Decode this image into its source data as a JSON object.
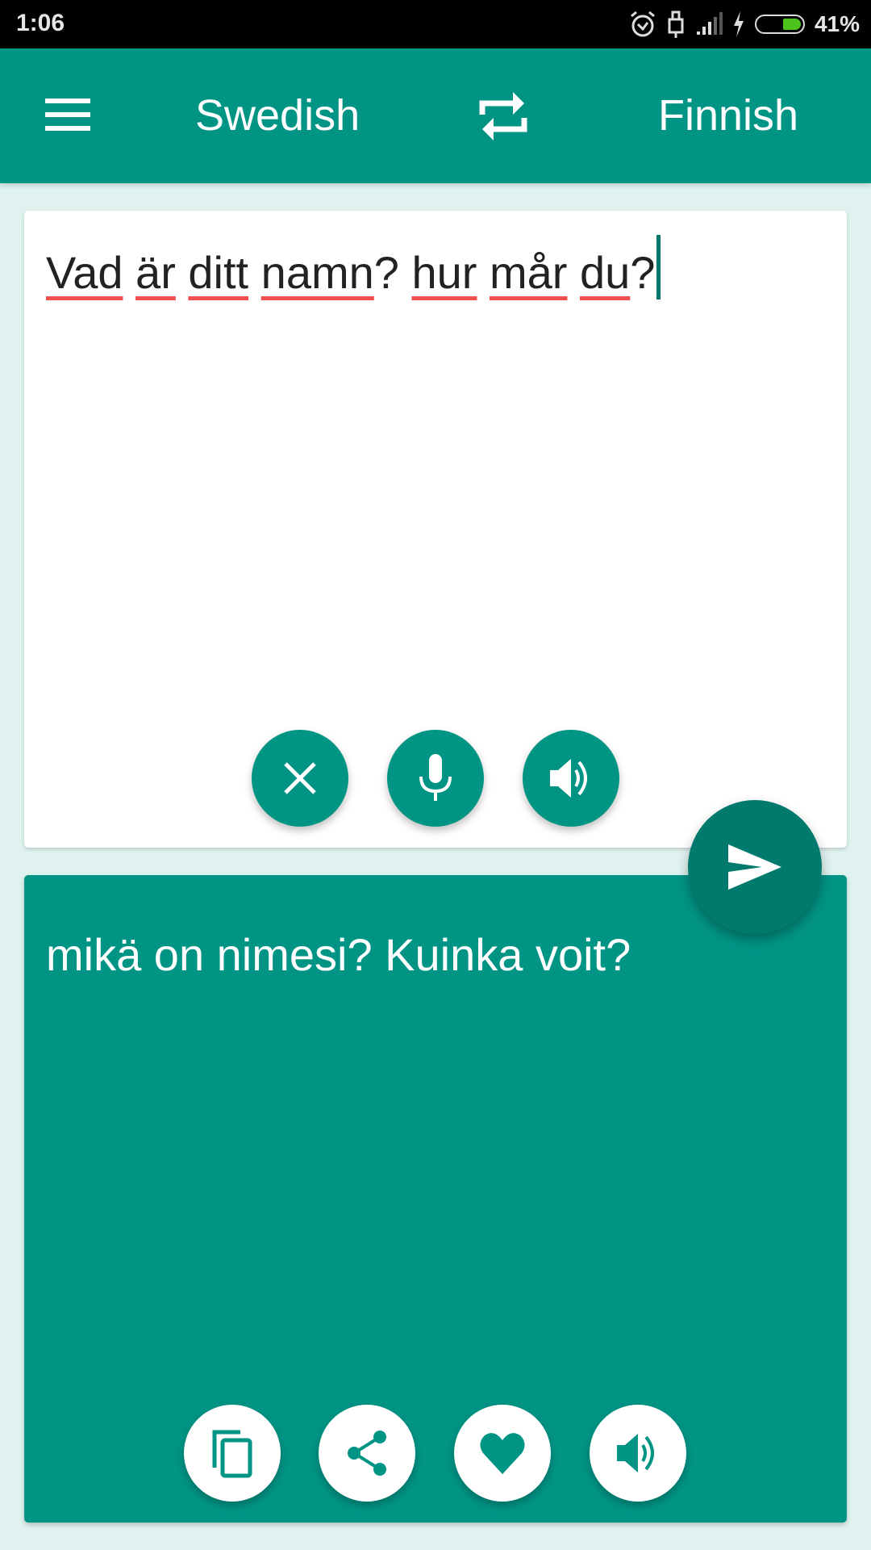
{
  "status_bar": {
    "time": "1:06",
    "battery_percent": "41%",
    "icons": [
      "alarm-icon",
      "usb-lock-icon",
      "signal-icon",
      "charging-icon",
      "battery-icon"
    ]
  },
  "app_bar": {
    "menu_icon": "hamburger-menu-icon",
    "source_language": "Swedish",
    "swap_icon": "swap-languages-icon",
    "target_language": "Finnish"
  },
  "input": {
    "words": [
      "Vad",
      "är",
      "ditt",
      "namn",
      "?",
      "hur",
      "mår",
      "du",
      "?"
    ],
    "text": "Vad är ditt namn? hur mår du?",
    "buttons": [
      {
        "name": "clear",
        "icon": "close-icon"
      },
      {
        "name": "voice-input",
        "icon": "microphone-icon"
      },
      {
        "name": "speak-source",
        "icon": "speaker-icon"
      }
    ]
  },
  "translate_button": {
    "icon": "send-icon"
  },
  "output": {
    "text": "mikä on nimesi? Kuinka voit?",
    "buttons": [
      {
        "name": "copy",
        "icon": "copy-icon"
      },
      {
        "name": "share",
        "icon": "share-icon"
      },
      {
        "name": "favorite",
        "icon": "heart-icon"
      },
      {
        "name": "speak-translation",
        "icon": "speaker-icon"
      }
    ]
  },
  "colors": {
    "primary": "#009485",
    "primary_dark": "#007a6c",
    "background": "#dff2ef",
    "spellcheck_underline": "#ef4f4f",
    "battery_fill": "#4cc21a"
  }
}
